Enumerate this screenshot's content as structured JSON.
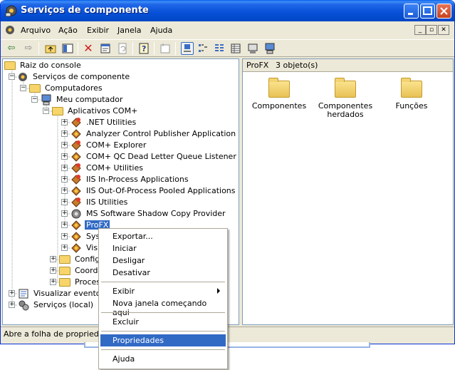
{
  "window": {
    "title": "Serviços de componente"
  },
  "menubar": {
    "items": [
      "Arquivo",
      "Ação",
      "Exibir",
      "Janela",
      "Ajuda"
    ]
  },
  "tree": {
    "items": [
      {
        "label": "Raiz do console",
        "icon": "folder-icon"
      },
      {
        "label": "Serviços de componente",
        "icon": "component-services-icon"
      },
      {
        "label": "Computadores",
        "icon": "folder-icon"
      },
      {
        "label": "Meu computador",
        "icon": "computer-icon"
      },
      {
        "label": "Aplicativos COM+",
        "icon": "folder-icon"
      },
      {
        "label": ".NET Utilities",
        "icon": "com-app-icon"
      },
      {
        "label": "Analyzer Control Publisher Application",
        "icon": "com-app-icon"
      },
      {
        "label": "COM+ Explorer",
        "icon": "com-app-icon"
      },
      {
        "label": "COM+ QC Dead Letter Queue Listener",
        "icon": "com-app-icon"
      },
      {
        "label": "COM+ Utilities",
        "icon": "com-app-icon"
      },
      {
        "label": "IIS In-Process Applications",
        "icon": "com-app-icon"
      },
      {
        "label": "IIS Out-Of-Process Pooled Applications",
        "icon": "com-app-icon"
      },
      {
        "label": "IIS Utilities",
        "icon": "com-app-icon"
      },
      {
        "label": "MS Software Shadow Copy Provider",
        "icon": "com-app-icon"
      },
      {
        "label": "ProFX",
        "icon": "com-app-icon"
      },
      {
        "label": "Sys",
        "icon": "com-app-icon"
      },
      {
        "label": "Visu",
        "icon": "com-app-icon"
      },
      {
        "label": "Config.",
        "icon": "folder-icon"
      },
      {
        "label": "Coorde",
        "icon": "folder-icon"
      },
      {
        "label": "Process",
        "icon": "folder-icon"
      },
      {
        "label": "Visualizar eventos (",
        "icon": "event-viewer-icon"
      },
      {
        "label": "Serviços (local)",
        "icon": "services-icon"
      }
    ]
  },
  "list": {
    "header_name": "ProFX",
    "header_count": "3 objeto(s)",
    "icons": [
      "Componentes",
      "Componentes herdados",
      "Funções"
    ]
  },
  "context_menu": {
    "items": [
      "Exportar...",
      "Iniciar",
      "Desligar",
      "Desativar",
      "Exibir",
      "Nova janela começando aqui",
      "Excluir",
      "Propriedades",
      "Ajuda"
    ]
  },
  "status": {
    "text": "Abre a folha de propriedade"
  },
  "colors": {
    "selection": "#316AC5",
    "titlebar": "#0750D7"
  }
}
